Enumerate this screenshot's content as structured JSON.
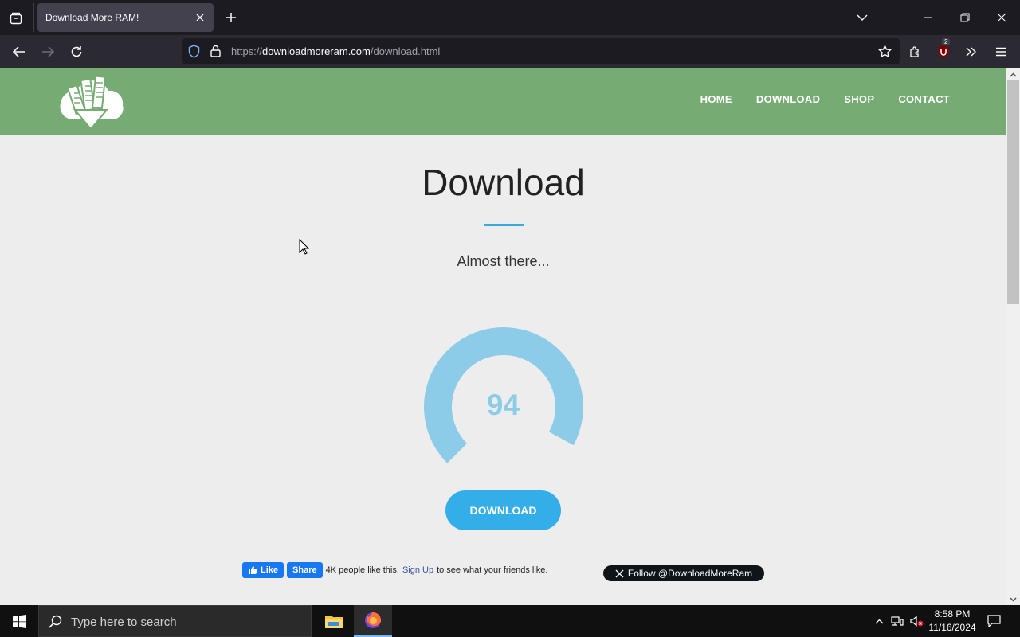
{
  "browser": {
    "tab_title": "Download More RAM!",
    "url_host": "downloadmoreram.com",
    "url_scheme": "https://",
    "url_path": "/download.html",
    "extension_badge": "2"
  },
  "site": {
    "nav": [
      "HOME",
      "DOWNLOAD",
      "SHOP",
      "CONTACT"
    ],
    "brand_color": "#76ab74",
    "accent_color": "#33aee8"
  },
  "main": {
    "title": "Download",
    "subtitle": "Almost there...",
    "progress_value": "94",
    "progress_fraction": 0.94,
    "download_button": "DOWNLOAD"
  },
  "social": {
    "fb_like": "Like",
    "fb_share": "Share",
    "fb_text": "4K people like this.",
    "fb_signup": "Sign Up",
    "fb_tail": "to see what your friends like.",
    "twitter_follow": "Follow @DownloadMoreRam"
  },
  "taskbar": {
    "search_placeholder": "Type here to search",
    "time": "8:58 PM",
    "date": "11/16/2024"
  }
}
